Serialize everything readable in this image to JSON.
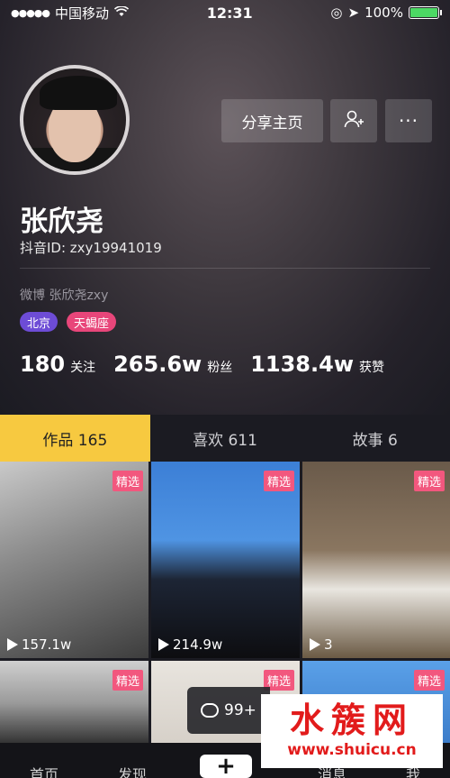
{
  "status_bar": {
    "carrier": "中国移动",
    "time": "12:31",
    "battery": "100%",
    "battery_level": 1.0
  },
  "profile": {
    "share_button": "分享主页",
    "more_button": "···",
    "name": "张欣尧",
    "douyin_id": "抖音ID: zxy19941019",
    "weibo": "微博 张欣尧zxy",
    "tags": [
      "北京",
      "天蝎座"
    ],
    "stats": [
      {
        "value": "180",
        "label": "关注"
      },
      {
        "value": "265.6w",
        "label": "粉丝"
      },
      {
        "value": "1138.4w",
        "label": "获赞"
      }
    ]
  },
  "tabs": [
    {
      "label": "作品 165",
      "active": true
    },
    {
      "label": "喜欢 611",
      "active": false
    },
    {
      "label": "故事 6",
      "active": false
    }
  ],
  "videos": [
    {
      "badge": "精选",
      "views": "157.1w"
    },
    {
      "badge": "精选",
      "views": "214.9w"
    },
    {
      "badge": "精选",
      "views": "3"
    },
    {
      "badge": "精选",
      "views": ""
    },
    {
      "badge": "精选",
      "views": ""
    },
    {
      "badge": "精选",
      "views": ""
    }
  ],
  "comment_pill": {
    "count": "99+"
  },
  "watermark": {
    "title": "水簇网",
    "url": "www.shuicu.cn"
  },
  "bottom_nav": {
    "home": "首页",
    "discover": "发现",
    "plus": "+",
    "messages": "消息",
    "me": "我"
  },
  "colors": {
    "active_tab": "#f7c940",
    "badge": "#f2577e",
    "tag_city": "#6d4cd6",
    "tag_sign": "#e8467a"
  }
}
